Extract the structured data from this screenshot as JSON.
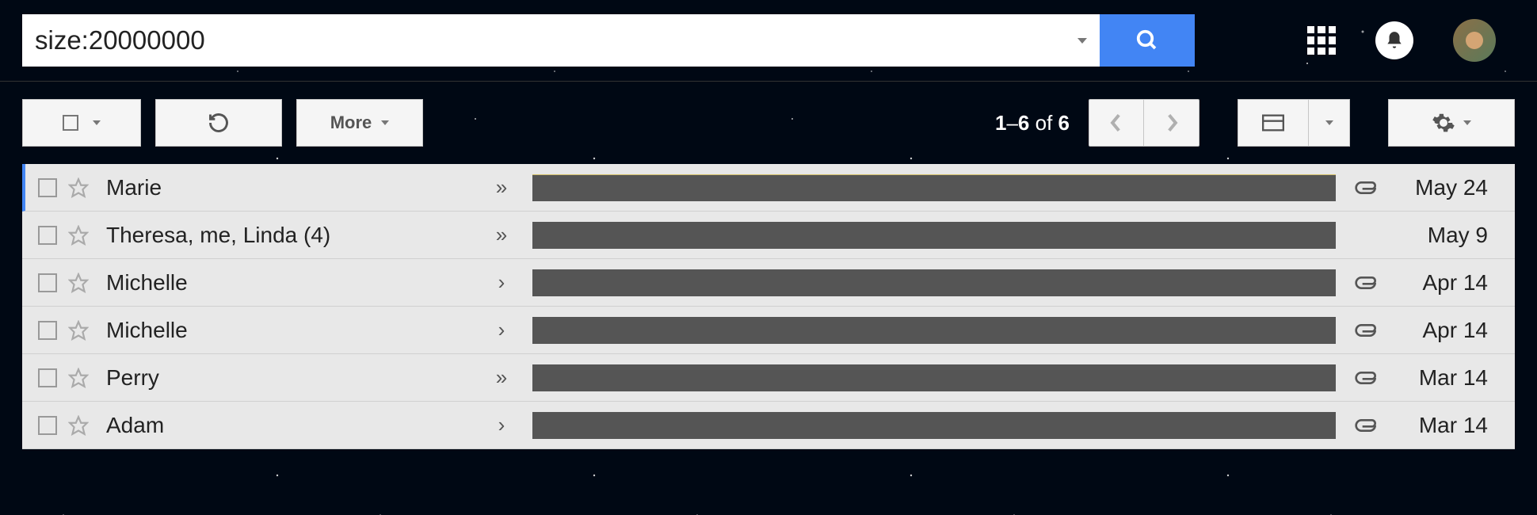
{
  "search": {
    "value": "size:20000000",
    "placeholder": ""
  },
  "toolbar": {
    "more_label": "More"
  },
  "pagination": {
    "range_start": "1",
    "range_end": "6",
    "of_label": "of",
    "total": "6"
  },
  "emails": [
    {
      "sender": "Marie",
      "marker": "»",
      "has_attachment": true,
      "date": "May 24"
    },
    {
      "sender": "Theresa, me, Linda (4)",
      "marker": "»",
      "has_attachment": false,
      "date": "May 9"
    },
    {
      "sender": "Michelle",
      "marker": "›",
      "has_attachment": true,
      "date": "Apr 14"
    },
    {
      "sender": "Michelle",
      "marker": "›",
      "has_attachment": true,
      "date": "Apr 14"
    },
    {
      "sender": "Perry",
      "marker": "»",
      "has_attachment": true,
      "date": "Mar 14"
    },
    {
      "sender": "Adam",
      "marker": "›",
      "has_attachment": true,
      "date": "Mar 14"
    }
  ]
}
